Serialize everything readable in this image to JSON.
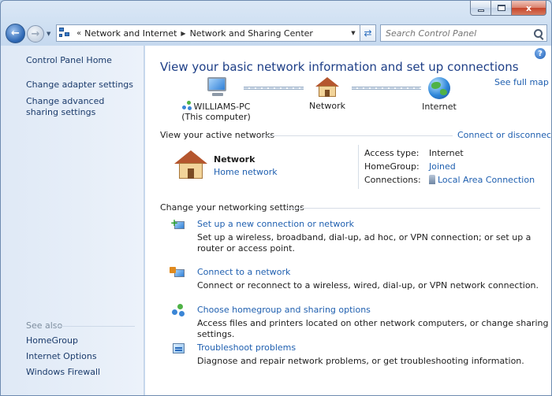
{
  "window": {
    "title": "Network and Sharing Center",
    "caption": {
      "close_glyph": "x"
    }
  },
  "nav": {
    "breadcrumb": [
      "Network and Internet",
      "Network and Sharing Center"
    ],
    "overflow_chevron": "«",
    "search_placeholder": "Search Control Panel"
  },
  "sidebar": {
    "home": "Control Panel Home",
    "links": [
      "Change adapter settings",
      "Change advanced sharing settings"
    ],
    "see_also_title": "See also",
    "see_also": [
      "HomeGroup",
      "Internet Options",
      "Windows Firewall"
    ]
  },
  "main": {
    "headline": "View your basic network information and set up connections",
    "see_full_map": "See full map",
    "map": {
      "computer_name": "WILLIAMS-PC",
      "computer_sub": "(This computer)",
      "network": "Network",
      "internet": "Internet"
    },
    "active_section": {
      "title": "View your active networks",
      "connect_disconnect": "Connect or disconnect",
      "network_name": "Network",
      "network_type": "Home network",
      "access_type_label": "Access type:",
      "access_type_value": "Internet",
      "homegroup_label": "HomeGroup:",
      "homegroup_value": "Joined",
      "connections_label": "Connections:",
      "connections_value": "Local Area Connection"
    },
    "settings_section": {
      "title": "Change your networking settings",
      "tasks": [
        {
          "label": "Set up a new connection or network",
          "icon": "new-connection-icon",
          "desc": "Set up a wireless, broadband, dial-up, ad hoc, or VPN connection; or set up a router or access point."
        },
        {
          "label": "Connect to a network",
          "icon": "connect-network-icon",
          "desc": "Connect or reconnect to a wireless, wired, dial-up, or VPN network connection."
        },
        {
          "label": "Choose homegroup and sharing options",
          "icon": "homegroup-icon",
          "desc": "Access files and printers located on other network computers, or change sharing settings."
        },
        {
          "label": "Troubleshoot problems",
          "icon": "troubleshoot-icon",
          "desc": "Diagnose and repair network problems, or get troubleshooting information."
        }
      ]
    }
  },
  "colors": {
    "link": "#2060b0",
    "headline": "#1e3f87",
    "sidebar_bg": "#dfe9f6",
    "frame": "#c6d9ef"
  }
}
